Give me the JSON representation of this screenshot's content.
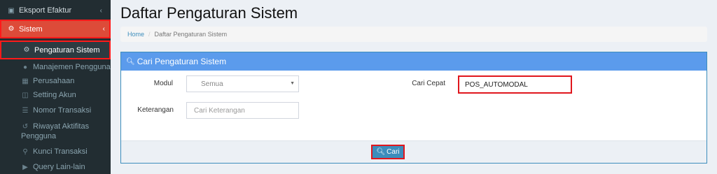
{
  "sidebar": {
    "eksport": {
      "label": "Eksport Efaktur",
      "icon": "export-icon"
    },
    "sistem": {
      "label": "Sistem",
      "icon": "gears-icon"
    },
    "items": [
      {
        "label": "Pengaturan Sistem",
        "icon": "gear-icon"
      },
      {
        "label": "Manajemen Pengguna",
        "icon": "users-icon"
      },
      {
        "label": "Perusahaan",
        "icon": "building-icon"
      },
      {
        "label": "Setting Akun",
        "icon": "copy-icon"
      },
      {
        "label": "Nomor Transaksi",
        "icon": "list-icon"
      },
      {
        "label": "Riwayat Aktifitas Pengguna",
        "icon": "history-icon"
      },
      {
        "label": "Kunci Transaksi",
        "icon": "key-icon"
      },
      {
        "label": "Query Lain-lain",
        "icon": "play-icon"
      }
    ]
  },
  "page": {
    "title": "Daftar Pengaturan Sistem"
  },
  "breadcrumb": {
    "home": "Home",
    "separator": "/",
    "current": "Daftar Pengaturan Sistem"
  },
  "panel": {
    "title": "Cari Pengaturan Sistem",
    "modul_label": "Modul",
    "modul_value": "Semua",
    "keterangan_label": "Keterangan",
    "keterangan_placeholder": "Cari Keterangan",
    "cari_cepat_label": "Cari Cepat",
    "cari_cepat_value": "POS_AUTOMODAL",
    "search_button": "Cari"
  },
  "colors": {
    "sidebar_bg": "#222d32",
    "active_menu": "#dd4b39",
    "panel_header": "#5b9bec",
    "button": "#3c8dbc",
    "highlight": "#e0161d"
  }
}
